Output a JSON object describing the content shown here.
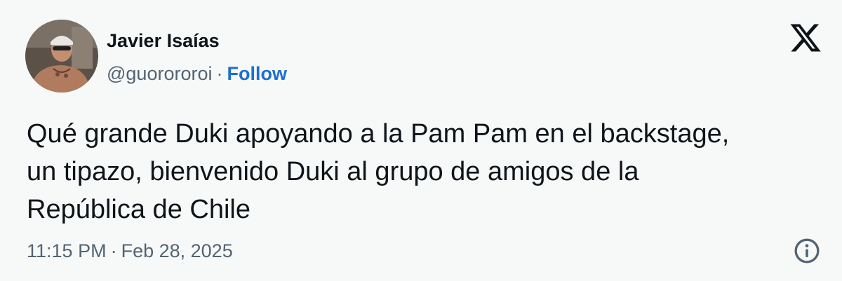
{
  "author": {
    "name": "Javier Isaías",
    "handle": "@guorororoi",
    "separator": "·",
    "follow_label": "Follow"
  },
  "tweet": {
    "lines": [
      "Qué grande Duki apoyando a la Pam Pam en el backstage,",
      "un tipazo, bienvenido Duki al grupo de amigos de la",
      "República de Chile"
    ],
    "time": "11:15 PM",
    "separator": "·",
    "date": "Feb 28, 2025"
  },
  "icons": {
    "logo": "x-logo-icon",
    "info": "info-icon"
  },
  "colors": {
    "background": "#f7f9f9",
    "text": "#0f1419",
    "secondary_text": "#536471",
    "follow": "#1d6fd1"
  }
}
